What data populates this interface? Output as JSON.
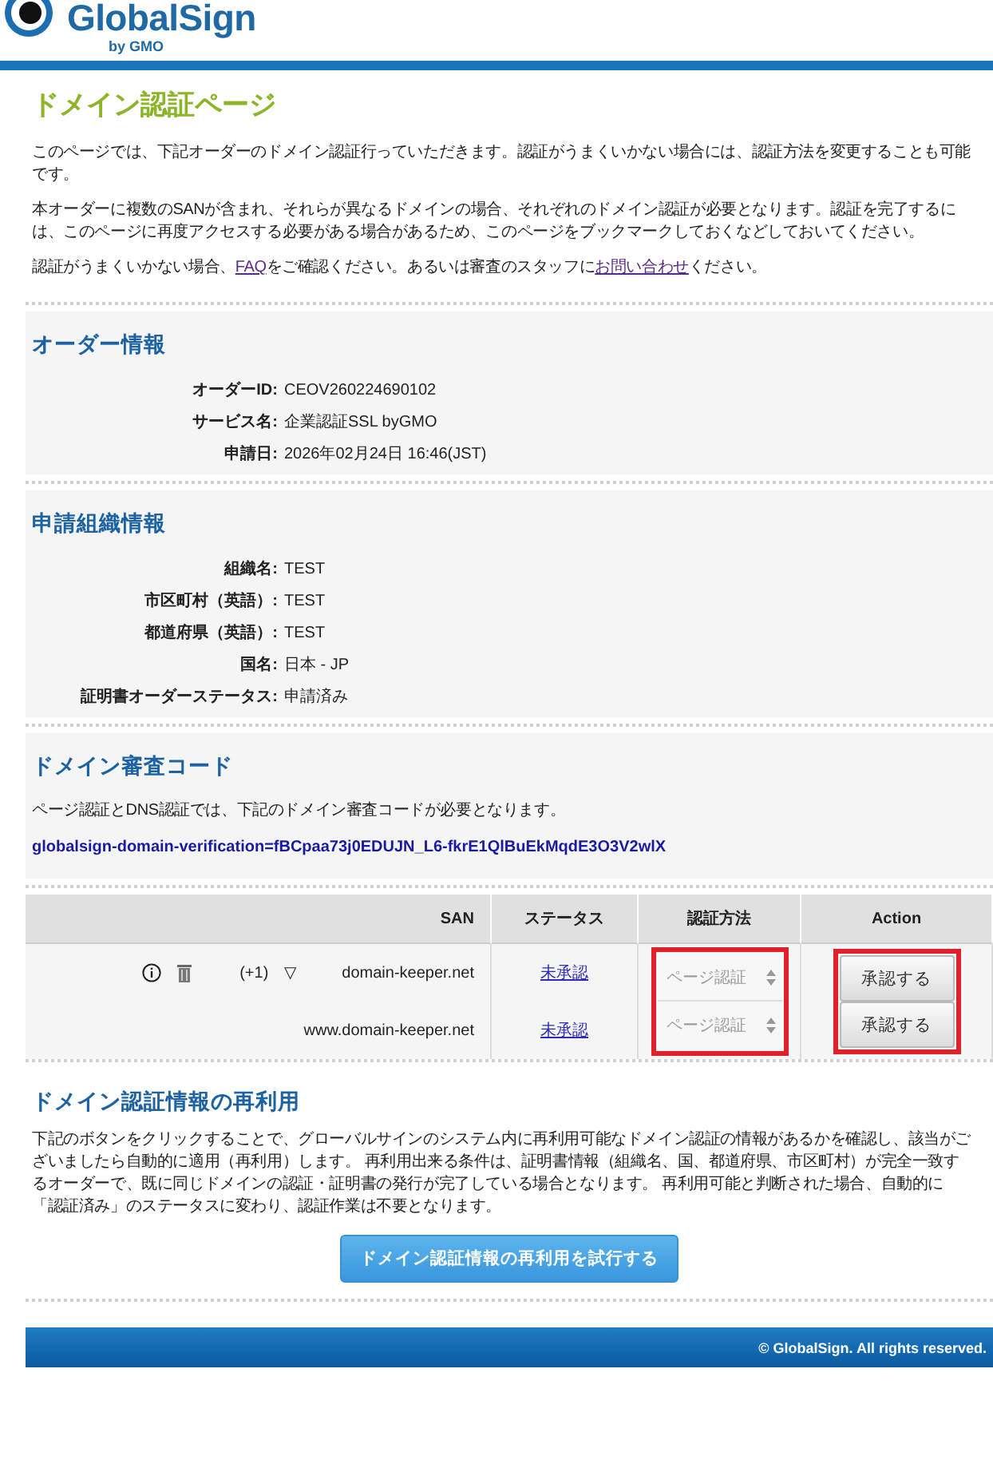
{
  "header": {
    "logo_name": "GlobalSign",
    "logo_sub": "by GMO"
  },
  "page_title": "ドメイン認証ページ",
  "intro": [
    "このページでは、下記オーダーのドメイン認証行っていただきます。認証がうまくいかない場合には、認証方法を変更することも可能です。",
    "本オーダーに複数のSANが含まれ、それらが異なるドメインの場合、それぞれのドメイン認証が必要となります。認証を完了するには、このページに再度アクセスする必要がある場合があるため、このページをブックマークしておくなどしておいてください。"
  ],
  "help": {
    "before": "認証がうまくいかない場合、",
    "faq_link": "FAQ",
    "middle": "をご確認ください。あるいは審査のスタッフに",
    "contact_link": "お問い合わせ",
    "after": "ください。"
  },
  "order_info": {
    "title": "オーダー情報",
    "fields": [
      {
        "label": "オーダーID:",
        "value": "CEOV260224690102"
      },
      {
        "label": "サービス名:",
        "value": "企業認証SSL byGMO"
      },
      {
        "label": "申請日:",
        "value": "2026年02月24日 16:46(JST)"
      }
    ]
  },
  "org_info": {
    "title": "申請組織情報",
    "fields": [
      {
        "label": "組織名:",
        "value": "TEST"
      },
      {
        "label": "市区町村（英語）:",
        "value": "TEST"
      },
      {
        "label": "都道府県（英語）:",
        "value": "TEST"
      },
      {
        "label": "国名:",
        "value": "日本 - JP"
      },
      {
        "label": "証明書オーダーステータス:",
        "value": "申請済み"
      }
    ]
  },
  "verification_code": {
    "title": "ドメイン審査コード",
    "description": "ページ認証とDNS認証では、下記のドメイン審査コードが必要となります。",
    "code": "globalsign-domain-verification=fBCpaa73j0EDUJN_L6-fkrE1QlBuEkMqdE3O3V2wlX"
  },
  "table": {
    "columns": [
      {
        "label": "SAN",
        "highlighted": false
      },
      {
        "label": "ステータス",
        "highlighted": false
      },
      {
        "label": "認証方法",
        "highlighted": true
      },
      {
        "label": "Action",
        "highlighted": true
      }
    ],
    "rows": [
      {
        "kind": "parent",
        "count": "(+1)",
        "toggle": "▽",
        "san": "domain-keeper.net",
        "status": "未承認",
        "method": "ページ認証",
        "action": "承認する"
      },
      {
        "kind": "child",
        "san": "www.domain-keeper.net",
        "status": "未承認",
        "method": "ページ認証",
        "action": "承認する"
      }
    ]
  },
  "reuse": {
    "title": "ドメイン認証情報の再利用",
    "description": "下記のボタンをクリックすることで、グローバルサインのシステム内に再利用可能なドメイン認証の情報があるかを確認し、該当がございましたら自動的に適用（再利用）します。 再利用出来る条件は、証明書情報（組織名、国、都道府県、市区町村）が完全一致するオーダーで、既に同じドメインの認証・証明書の発行が完了している場合となります。 再利用可能と判断された場合、自動的に「認証済み」のステータスに変わり、認証作業は不要となります。",
    "button": "ドメイン認証情報の再利用を試行する"
  },
  "footer": {
    "copyright": "© GlobalSign. All rights reserved."
  }
}
